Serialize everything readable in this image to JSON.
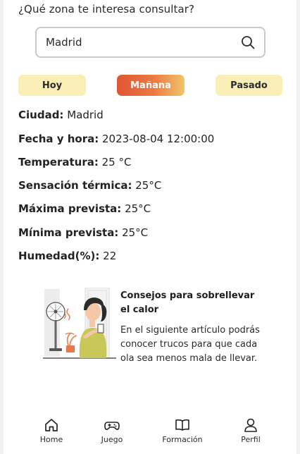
{
  "search": {
    "question": "¿Qué zona te interesa consultar?",
    "value": "Madrid"
  },
  "days": {
    "today": "Hoy",
    "tomorrow": "Mañana",
    "after": "Pasado",
    "selected": "Mañana"
  },
  "weather": {
    "city_label": "Ciudad:",
    "city": "Madrid",
    "datetime_label": "Fecha y hora:",
    "datetime": "2023-08-04 12:00:00",
    "temp_label": "Temperatura:",
    "temp": "25 °C",
    "feels_label": "Sensación térmica:",
    "feels": "25°C",
    "max_label": "Máxima prevista:",
    "max": "25°C",
    "min_label": "Mínima prevista:",
    "min": "25°C",
    "humidity_label": "Humedad(%):",
    "humidity": "22"
  },
  "tip": {
    "title": "Consejos para sobrellevar el calor",
    "body": "En el siguiente artículo podrás conocer trucos para que cada ola sea menos mala de llevar."
  },
  "nav": {
    "home": "Home",
    "game": "Juego",
    "learn": "Formación",
    "profile": "Perfil"
  },
  "colors": {
    "accent_start": "#e05535",
    "accent_end": "#f2c56a",
    "day_inactive": "#f9eeb6"
  }
}
